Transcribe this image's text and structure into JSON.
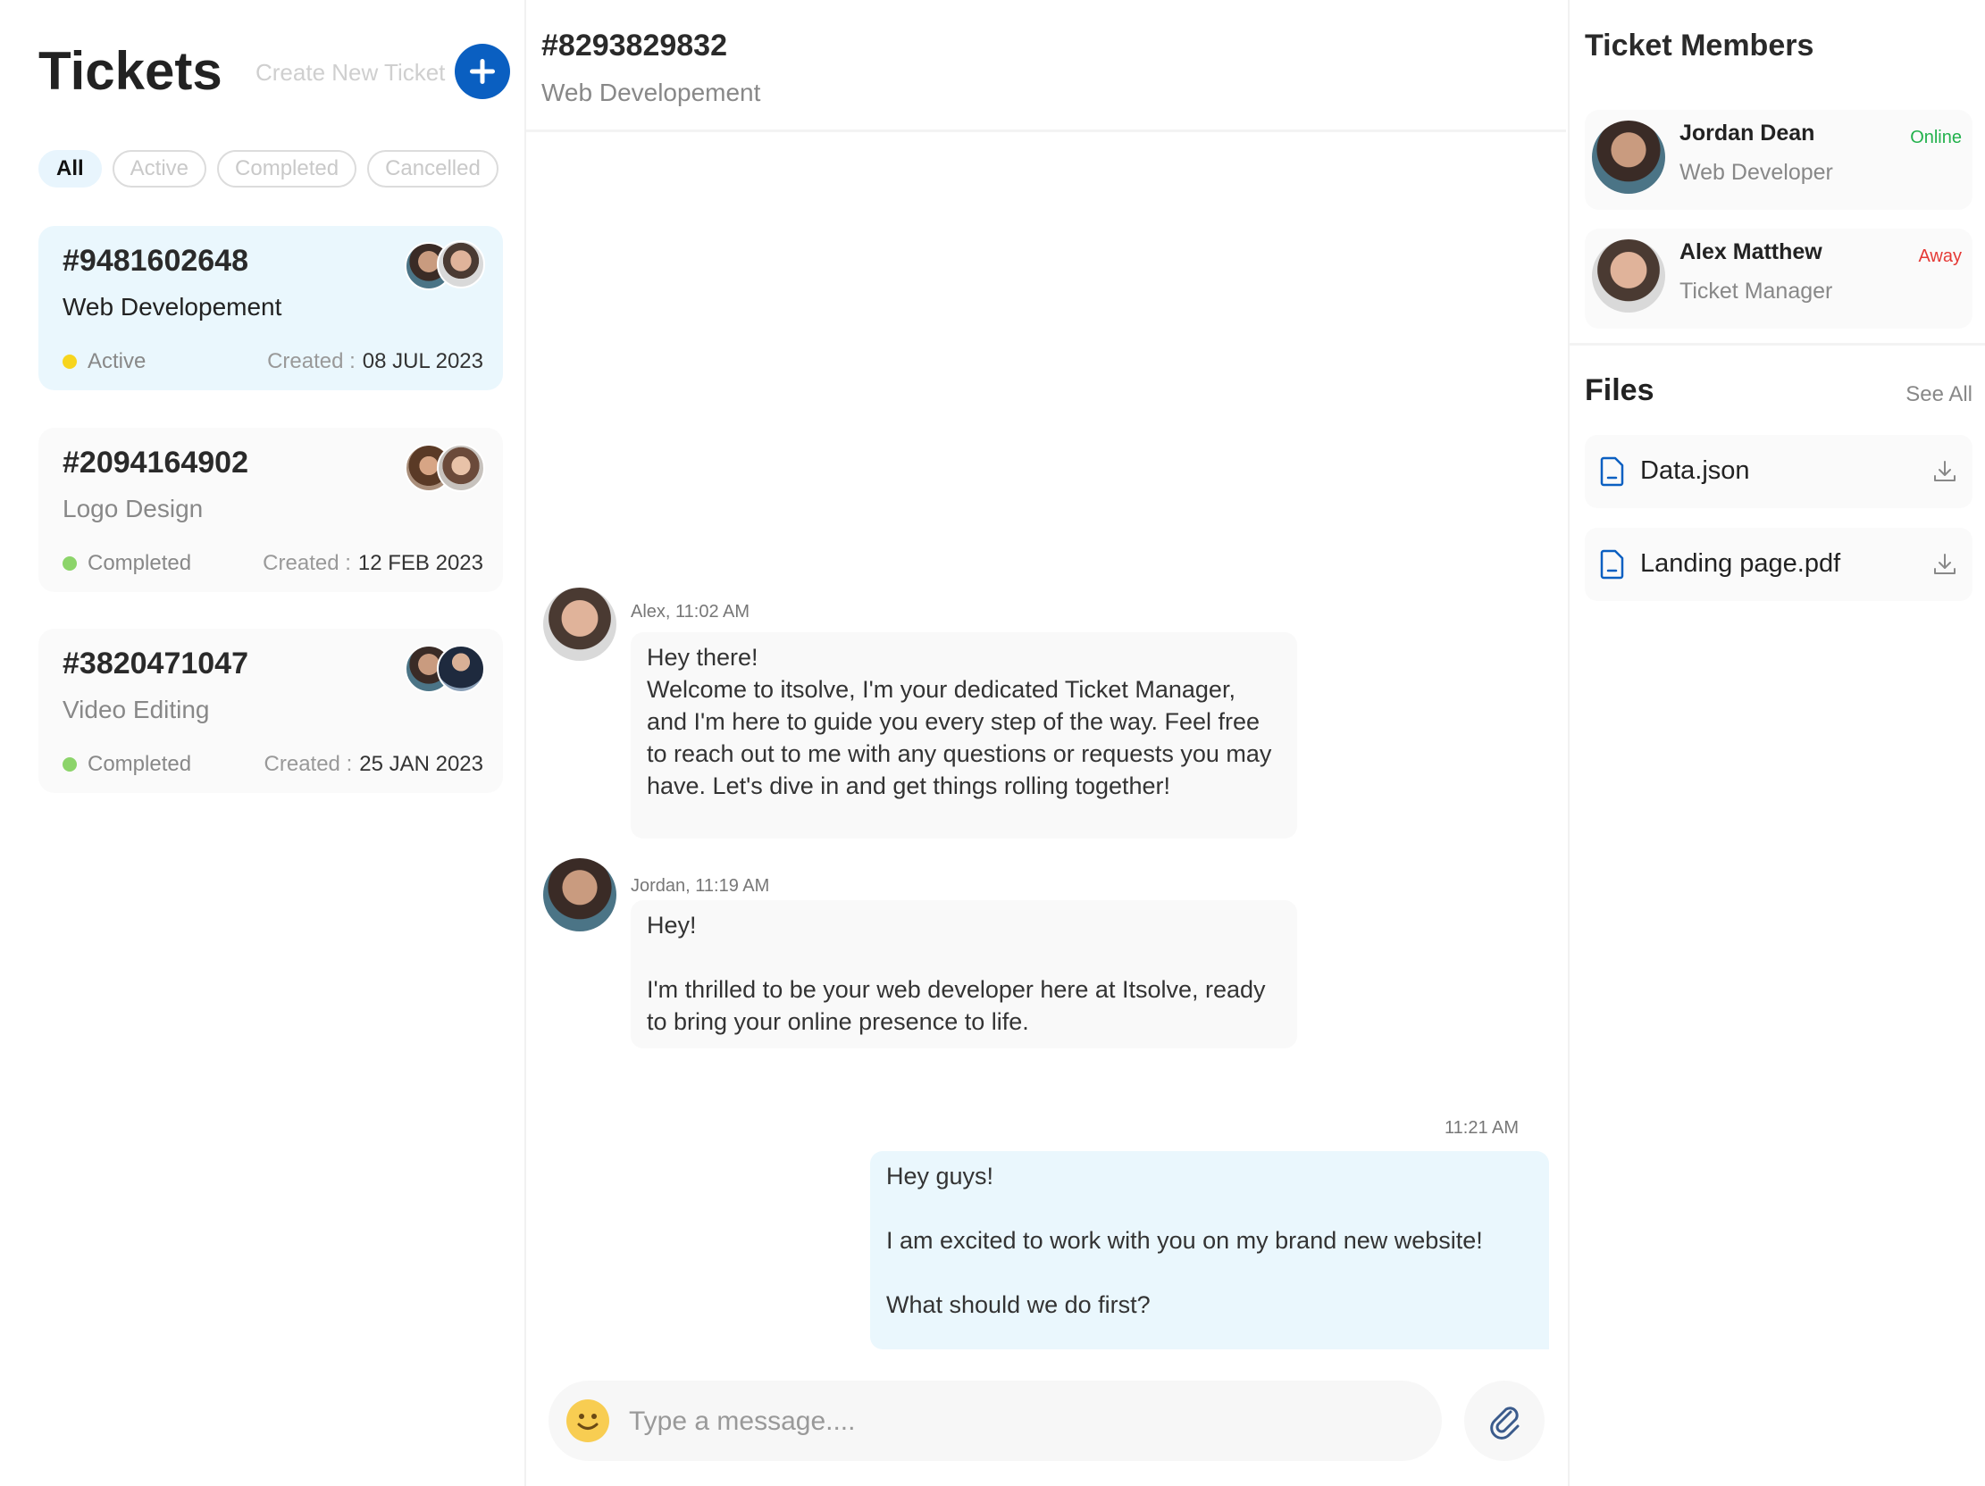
{
  "sidebar": {
    "title": "Tickets",
    "create_label": "Create New Ticket",
    "filters": [
      "All",
      "Active",
      "Completed",
      "Cancelled"
    ],
    "tickets": [
      {
        "id": "#9481602648",
        "name": "Web Developement",
        "status": "Active",
        "status_color": "#f7d51e",
        "created_label": "Created :",
        "date": "08 JUL 2023"
      },
      {
        "id": "#2094164902",
        "name": "Logo Design",
        "status": "Completed",
        "status_color": "#8cd46a",
        "created_label": "Created :",
        "date": "12 FEB 2023"
      },
      {
        "id": "#3820471047",
        "name": "Video Editing",
        "status": "Completed",
        "status_color": "#8cd46a",
        "created_label": "Created :",
        "date": "25 JAN 2023"
      }
    ]
  },
  "chat": {
    "ticket_id": "#8293829832",
    "ticket_name": "Web Developement",
    "messages": [
      {
        "meta": "Alex, 11:02 AM",
        "text": "Hey there!\nWelcome to itsolve, I'm your dedicated Ticket Manager, and I'm here to guide you every step of the way. Feel free to reach out to me with any questions or requests you may have. Let's dive in and get things rolling together!"
      },
      {
        "meta": "Jordan, 11:19 AM",
        "text": "Hey!\n\nI'm thrilled to be your web developer here at Itsolve, ready to bring your online presence to life."
      },
      {
        "meta": "11:21 AM",
        "text": "Hey guys!\n\nI am excited to work with you on my brand new website!\n\nWhat should we do first?"
      }
    ],
    "composer_placeholder": "Type a message...."
  },
  "members_panel": {
    "title": "Ticket Members",
    "members": [
      {
        "name": "Jordan Dean",
        "role": "Web Developer",
        "status": "Online",
        "status_color": "#22b14c"
      },
      {
        "name": "Alex Matthew",
        "role": "Ticket Manager",
        "status": "Away",
        "status_color": "#e53935"
      }
    ]
  },
  "files_panel": {
    "title": "Files",
    "see_all": "See All",
    "files": [
      "Data.json",
      "Landing page.pdf"
    ]
  },
  "colors": {
    "accent": "#0a5fc1",
    "selected_bg": "#eaf7fd"
  }
}
